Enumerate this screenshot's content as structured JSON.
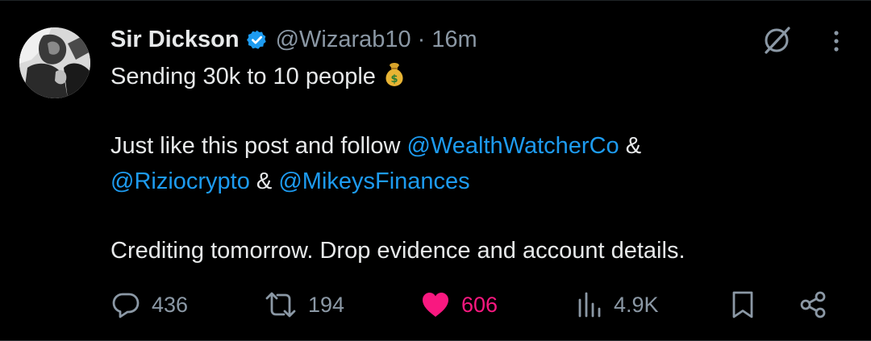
{
  "author": {
    "name": "Sir Dickson",
    "handle": "@Wizarab10",
    "separator": "·",
    "time": "16m",
    "verified": true
  },
  "post": {
    "line1": "Sending 30k to 10 people",
    "emoji": "money-bag-emoji",
    "para2_prefix": "Just like this post and follow ",
    "mention1": "@WealthWatcherCo",
    "amp1": " &",
    "mention2": "@Riziocrypto",
    "amp2": " & ",
    "mention3": "@MikeysFinances",
    "line_last": "Crediting tomorrow. Drop evidence and account details."
  },
  "actions": {
    "replies": "436",
    "reposts": "194",
    "likes": "606",
    "views": "4.9K"
  },
  "colors": {
    "background": "#000000",
    "text": "#e7e9ea",
    "secondary": "#8b98a5",
    "link": "#1d9bf0",
    "like": "#f91880",
    "verified": "#1d9bf0"
  },
  "icons": {
    "reply": "reply-icon",
    "repost": "repost-icon",
    "like": "heart-icon",
    "views": "views-icon",
    "bookmark": "bookmark-icon",
    "share": "share-icon",
    "grok": "grok-icon",
    "more": "more-icon"
  }
}
